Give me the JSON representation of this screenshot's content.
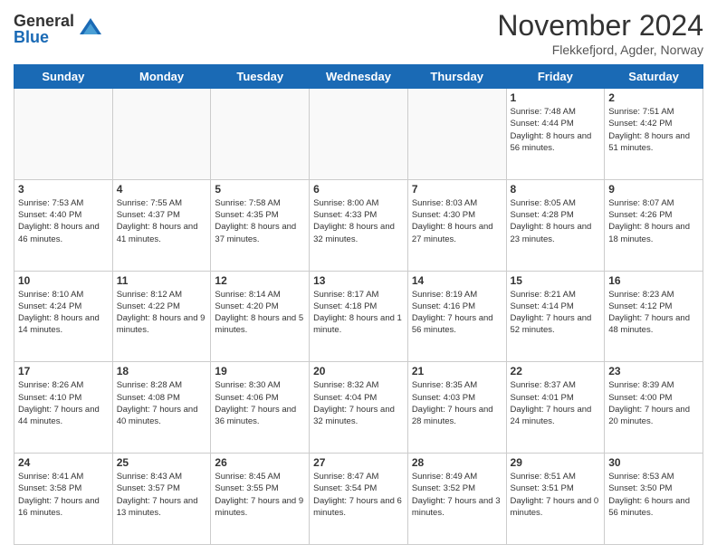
{
  "logo": {
    "general": "General",
    "blue": "Blue"
  },
  "title": "November 2024",
  "location": "Flekkefjord, Agder, Norway",
  "days_of_week": [
    "Sunday",
    "Monday",
    "Tuesday",
    "Wednesday",
    "Thursday",
    "Friday",
    "Saturday"
  ],
  "weeks": [
    [
      {
        "day": "",
        "info": ""
      },
      {
        "day": "",
        "info": ""
      },
      {
        "day": "",
        "info": ""
      },
      {
        "day": "",
        "info": ""
      },
      {
        "day": "",
        "info": ""
      },
      {
        "day": "1",
        "info": "Sunrise: 7:48 AM\nSunset: 4:44 PM\nDaylight: 8 hours and 56 minutes."
      },
      {
        "day": "2",
        "info": "Sunrise: 7:51 AM\nSunset: 4:42 PM\nDaylight: 8 hours and 51 minutes."
      }
    ],
    [
      {
        "day": "3",
        "info": "Sunrise: 7:53 AM\nSunset: 4:40 PM\nDaylight: 8 hours and 46 minutes."
      },
      {
        "day": "4",
        "info": "Sunrise: 7:55 AM\nSunset: 4:37 PM\nDaylight: 8 hours and 41 minutes."
      },
      {
        "day": "5",
        "info": "Sunrise: 7:58 AM\nSunset: 4:35 PM\nDaylight: 8 hours and 37 minutes."
      },
      {
        "day": "6",
        "info": "Sunrise: 8:00 AM\nSunset: 4:33 PM\nDaylight: 8 hours and 32 minutes."
      },
      {
        "day": "7",
        "info": "Sunrise: 8:03 AM\nSunset: 4:30 PM\nDaylight: 8 hours and 27 minutes."
      },
      {
        "day": "8",
        "info": "Sunrise: 8:05 AM\nSunset: 4:28 PM\nDaylight: 8 hours and 23 minutes."
      },
      {
        "day": "9",
        "info": "Sunrise: 8:07 AM\nSunset: 4:26 PM\nDaylight: 8 hours and 18 minutes."
      }
    ],
    [
      {
        "day": "10",
        "info": "Sunrise: 8:10 AM\nSunset: 4:24 PM\nDaylight: 8 hours and 14 minutes."
      },
      {
        "day": "11",
        "info": "Sunrise: 8:12 AM\nSunset: 4:22 PM\nDaylight: 8 hours and 9 minutes."
      },
      {
        "day": "12",
        "info": "Sunrise: 8:14 AM\nSunset: 4:20 PM\nDaylight: 8 hours and 5 minutes."
      },
      {
        "day": "13",
        "info": "Sunrise: 8:17 AM\nSunset: 4:18 PM\nDaylight: 8 hours and 1 minute."
      },
      {
        "day": "14",
        "info": "Sunrise: 8:19 AM\nSunset: 4:16 PM\nDaylight: 7 hours and 56 minutes."
      },
      {
        "day": "15",
        "info": "Sunrise: 8:21 AM\nSunset: 4:14 PM\nDaylight: 7 hours and 52 minutes."
      },
      {
        "day": "16",
        "info": "Sunrise: 8:23 AM\nSunset: 4:12 PM\nDaylight: 7 hours and 48 minutes."
      }
    ],
    [
      {
        "day": "17",
        "info": "Sunrise: 8:26 AM\nSunset: 4:10 PM\nDaylight: 7 hours and 44 minutes."
      },
      {
        "day": "18",
        "info": "Sunrise: 8:28 AM\nSunset: 4:08 PM\nDaylight: 7 hours and 40 minutes."
      },
      {
        "day": "19",
        "info": "Sunrise: 8:30 AM\nSunset: 4:06 PM\nDaylight: 7 hours and 36 minutes."
      },
      {
        "day": "20",
        "info": "Sunrise: 8:32 AM\nSunset: 4:04 PM\nDaylight: 7 hours and 32 minutes."
      },
      {
        "day": "21",
        "info": "Sunrise: 8:35 AM\nSunset: 4:03 PM\nDaylight: 7 hours and 28 minutes."
      },
      {
        "day": "22",
        "info": "Sunrise: 8:37 AM\nSunset: 4:01 PM\nDaylight: 7 hours and 24 minutes."
      },
      {
        "day": "23",
        "info": "Sunrise: 8:39 AM\nSunset: 4:00 PM\nDaylight: 7 hours and 20 minutes."
      }
    ],
    [
      {
        "day": "24",
        "info": "Sunrise: 8:41 AM\nSunset: 3:58 PM\nDaylight: 7 hours and 16 minutes."
      },
      {
        "day": "25",
        "info": "Sunrise: 8:43 AM\nSunset: 3:57 PM\nDaylight: 7 hours and 13 minutes."
      },
      {
        "day": "26",
        "info": "Sunrise: 8:45 AM\nSunset: 3:55 PM\nDaylight: 7 hours and 9 minutes."
      },
      {
        "day": "27",
        "info": "Sunrise: 8:47 AM\nSunset: 3:54 PM\nDaylight: 7 hours and 6 minutes."
      },
      {
        "day": "28",
        "info": "Sunrise: 8:49 AM\nSunset: 3:52 PM\nDaylight: 7 hours and 3 minutes."
      },
      {
        "day": "29",
        "info": "Sunrise: 8:51 AM\nSunset: 3:51 PM\nDaylight: 7 hours and 0 minutes."
      },
      {
        "day": "30",
        "info": "Sunrise: 8:53 AM\nSunset: 3:50 PM\nDaylight: 6 hours and 56 minutes."
      }
    ]
  ]
}
